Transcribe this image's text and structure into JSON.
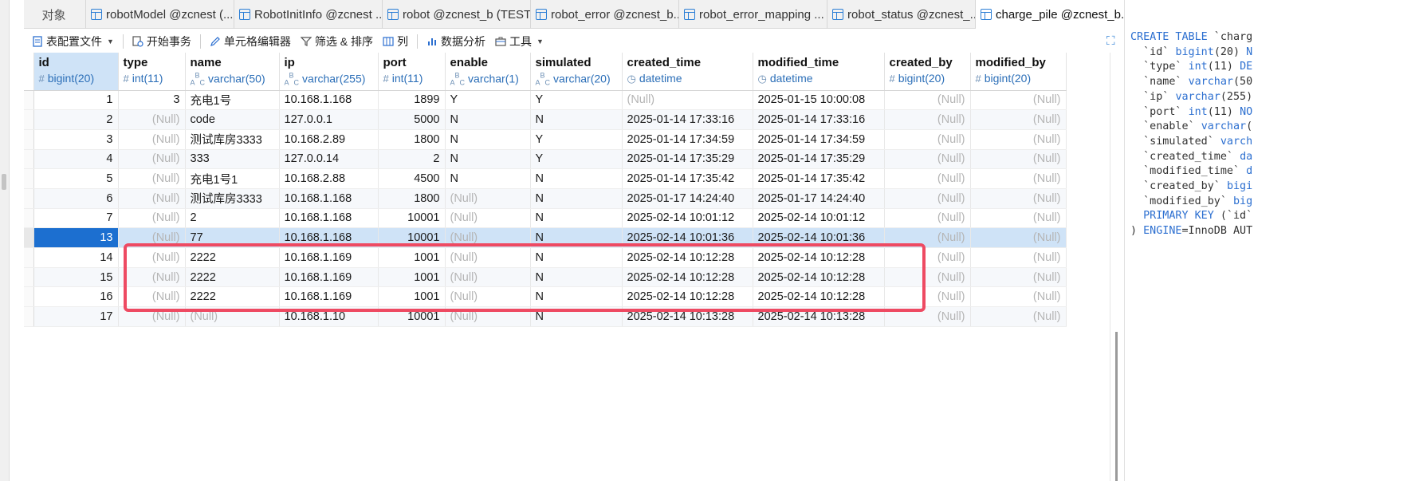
{
  "tabs": [
    {
      "label": "对象",
      "active": false,
      "icon": "none"
    },
    {
      "label": "robotModel @zcnest (...",
      "active": false,
      "icon": "table-icon"
    },
    {
      "label": "RobotInitInfo @zcnest ...",
      "active": false,
      "icon": "table-icon"
    },
    {
      "label": "robot @zcnest_b (TEST...",
      "active": false,
      "icon": "table-icon"
    },
    {
      "label": "robot_error @zcnest_b...",
      "active": false,
      "icon": "table-icon"
    },
    {
      "label": "robot_error_mapping ...",
      "active": false,
      "icon": "table-icon"
    },
    {
      "label": "robot_status @zcnest_...",
      "active": false,
      "icon": "table-icon"
    },
    {
      "label": "charge_pile @zcnest_b...",
      "active": true,
      "icon": "table-icon"
    }
  ],
  "toolbar": {
    "table_config": "表配置文件",
    "begin_transaction": "开始事务",
    "cell_editor": "单元格编辑器",
    "filter_sort": "筛选 & 排序",
    "columns": "列",
    "data_analysis": "数据分析",
    "tools": "工具"
  },
  "grid": {
    "columns": [
      {
        "name": "id",
        "type": "bigint(20)",
        "symbol": "#"
      },
      {
        "name": "type",
        "type": "int(11)",
        "symbol": "#"
      },
      {
        "name": "name",
        "type": "varchar(50)",
        "symbol": "ABC"
      },
      {
        "name": "ip",
        "type": "varchar(255)",
        "symbol": "ABC"
      },
      {
        "name": "port",
        "type": "int(11)",
        "symbol": "#"
      },
      {
        "name": "enable",
        "type": "varchar(1)",
        "symbol": "ABC"
      },
      {
        "name": "simulated",
        "type": "varchar(20)",
        "symbol": "ABC"
      },
      {
        "name": "created_time",
        "type": "datetime",
        "symbol": "clock"
      },
      {
        "name": "modified_time",
        "type": "datetime",
        "symbol": "clock"
      },
      {
        "name": "created_by",
        "type": "bigint(20)",
        "symbol": "#"
      },
      {
        "name": "modified_by",
        "type": "bigint(20)",
        "symbol": "#"
      }
    ],
    "rows": [
      [
        "1",
        "3",
        "充电1号",
        "10.168.1.168",
        "1899",
        "Y",
        "Y",
        "(Null)",
        "2025-01-15 10:00:08",
        "(Null)",
        "(Null)"
      ],
      [
        "2",
        "(Null)",
        "code",
        "127.0.0.1",
        "5000",
        "N",
        "N",
        "2025-01-14 17:33:16",
        "2025-01-14 17:33:16",
        "(Null)",
        "(Null)"
      ],
      [
        "3",
        "(Null)",
        "测试库房3333",
        "10.168.2.89",
        "1800",
        "N",
        "Y",
        "2025-01-14 17:34:59",
        "2025-01-14 17:34:59",
        "(Null)",
        "(Null)"
      ],
      [
        "4",
        "(Null)",
        "333",
        "127.0.0.14",
        "2",
        "N",
        "Y",
        "2025-01-14 17:35:29",
        "2025-01-14 17:35:29",
        "(Null)",
        "(Null)"
      ],
      [
        "5",
        "(Null)",
        "充电1号1",
        "10.168.2.88",
        "4500",
        "N",
        "N",
        "2025-01-14 17:35:42",
        "2025-01-14 17:35:42",
        "(Null)",
        "(Null)"
      ],
      [
        "6",
        "(Null)",
        "测试库房3333",
        "10.168.1.168",
        "1800",
        "(Null)",
        "N",
        "2025-01-17 14:24:40",
        "2025-01-17 14:24:40",
        "(Null)",
        "(Null)"
      ],
      [
        "7",
        "(Null)",
        "2",
        "10.168.1.168",
        "10001",
        "(Null)",
        "N",
        "2025-02-14 10:01:12",
        "2025-02-14 10:01:12",
        "(Null)",
        "(Null)"
      ],
      [
        "13",
        "(Null)",
        "77",
        "10.168.1.168",
        "10001",
        "(Null)",
        "N",
        "2025-02-14 10:01:36",
        "2025-02-14 10:01:36",
        "(Null)",
        "(Null)"
      ],
      [
        "14",
        "(Null)",
        "2222",
        "10.168.1.169",
        "1001",
        "(Null)",
        "N",
        "2025-02-14 10:12:28",
        "2025-02-14 10:12:28",
        "(Null)",
        "(Null)"
      ],
      [
        "15",
        "(Null)",
        "2222",
        "10.168.1.169",
        "1001",
        "(Null)",
        "N",
        "2025-02-14 10:12:28",
        "2025-02-14 10:12:28",
        "(Null)",
        "(Null)"
      ],
      [
        "16",
        "(Null)",
        "2222",
        "10.168.1.169",
        "1001",
        "(Null)",
        "N",
        "2025-02-14 10:12:28",
        "2025-02-14 10:12:28",
        "(Null)",
        "(Null)"
      ],
      [
        "17",
        "(Null)",
        "(Null)",
        "10.168.1.10",
        "10001",
        "(Null)",
        "N",
        "2025-02-14 10:13:28",
        "2025-02-14 10:13:28",
        "(Null)",
        "(Null)"
      ]
    ],
    "selected_row_index": 7,
    "null_text": "(Null)"
  },
  "ddl": {
    "lines": [
      "CREATE TABLE `charg",
      "  `id` bigint(20) N",
      "  `type` int(11) DE",
      "  `name` varchar(50",
      "  `ip` varchar(255)",
      "  `port` int(11) NO",
      "  `enable` varchar(",
      "  `simulated` varch",
      "  `created_time` da",
      "  `modified_time` d",
      "  `created_by` bigi",
      "  `modified_by` big",
      "  PRIMARY KEY (`id`",
      ") ENGINE=InnoDB AUT"
    ]
  },
  "colors": {
    "accent": "#2c6fd0",
    "selected_row": "#cfe3f7",
    "selected_cell": "#1c6fd0",
    "highlight_box": "#ee4a62",
    "null_text": "#b5b5b5"
  }
}
